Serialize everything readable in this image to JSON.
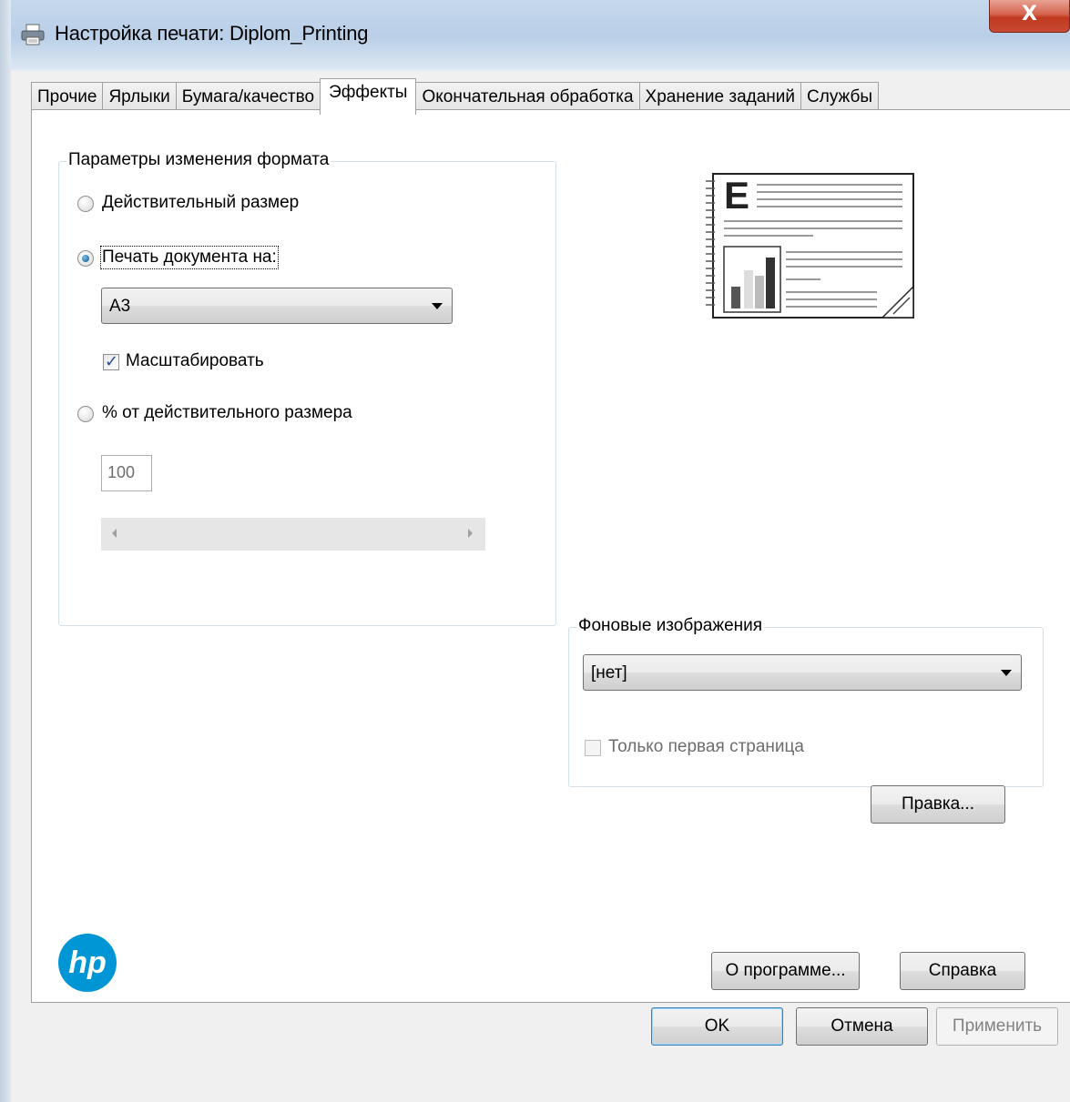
{
  "window": {
    "title": "Настройка печати: Diplom_Printing",
    "close_label": "X"
  },
  "tabs": [
    {
      "label": "Прочие"
    },
    {
      "label": "Ярлыки"
    },
    {
      "label": "Бумага/качество"
    },
    {
      "label": "Эффекты",
      "active": true
    },
    {
      "label": "Окончательная обработка"
    },
    {
      "label": "Хранение заданий"
    },
    {
      "label": "Службы"
    }
  ],
  "resize": {
    "group_label": "Параметры изменения формата",
    "actual_size_label": "Действительный размер",
    "print_on_label": "Печать документа на:",
    "paper_value": "A3",
    "scale_label": "Масштабировать",
    "scale_checked": true,
    "percent_label": "% от действительного размера",
    "percent_value": "100",
    "selected": "print_on"
  },
  "watermark": {
    "group_label": "Фоновые изображения",
    "value": "[нет]",
    "first_page_label": "Только первая страница",
    "edit_label": "Правка..."
  },
  "logo": {
    "text": "hp",
    "color": "#0096d6"
  },
  "buttons": {
    "about": "О программе...",
    "help": "Справка",
    "ok": "OK",
    "cancel": "Отмена",
    "apply": "Применить"
  },
  "icons": {
    "printer": "printer-icon",
    "preview": "document-preview-icon"
  }
}
